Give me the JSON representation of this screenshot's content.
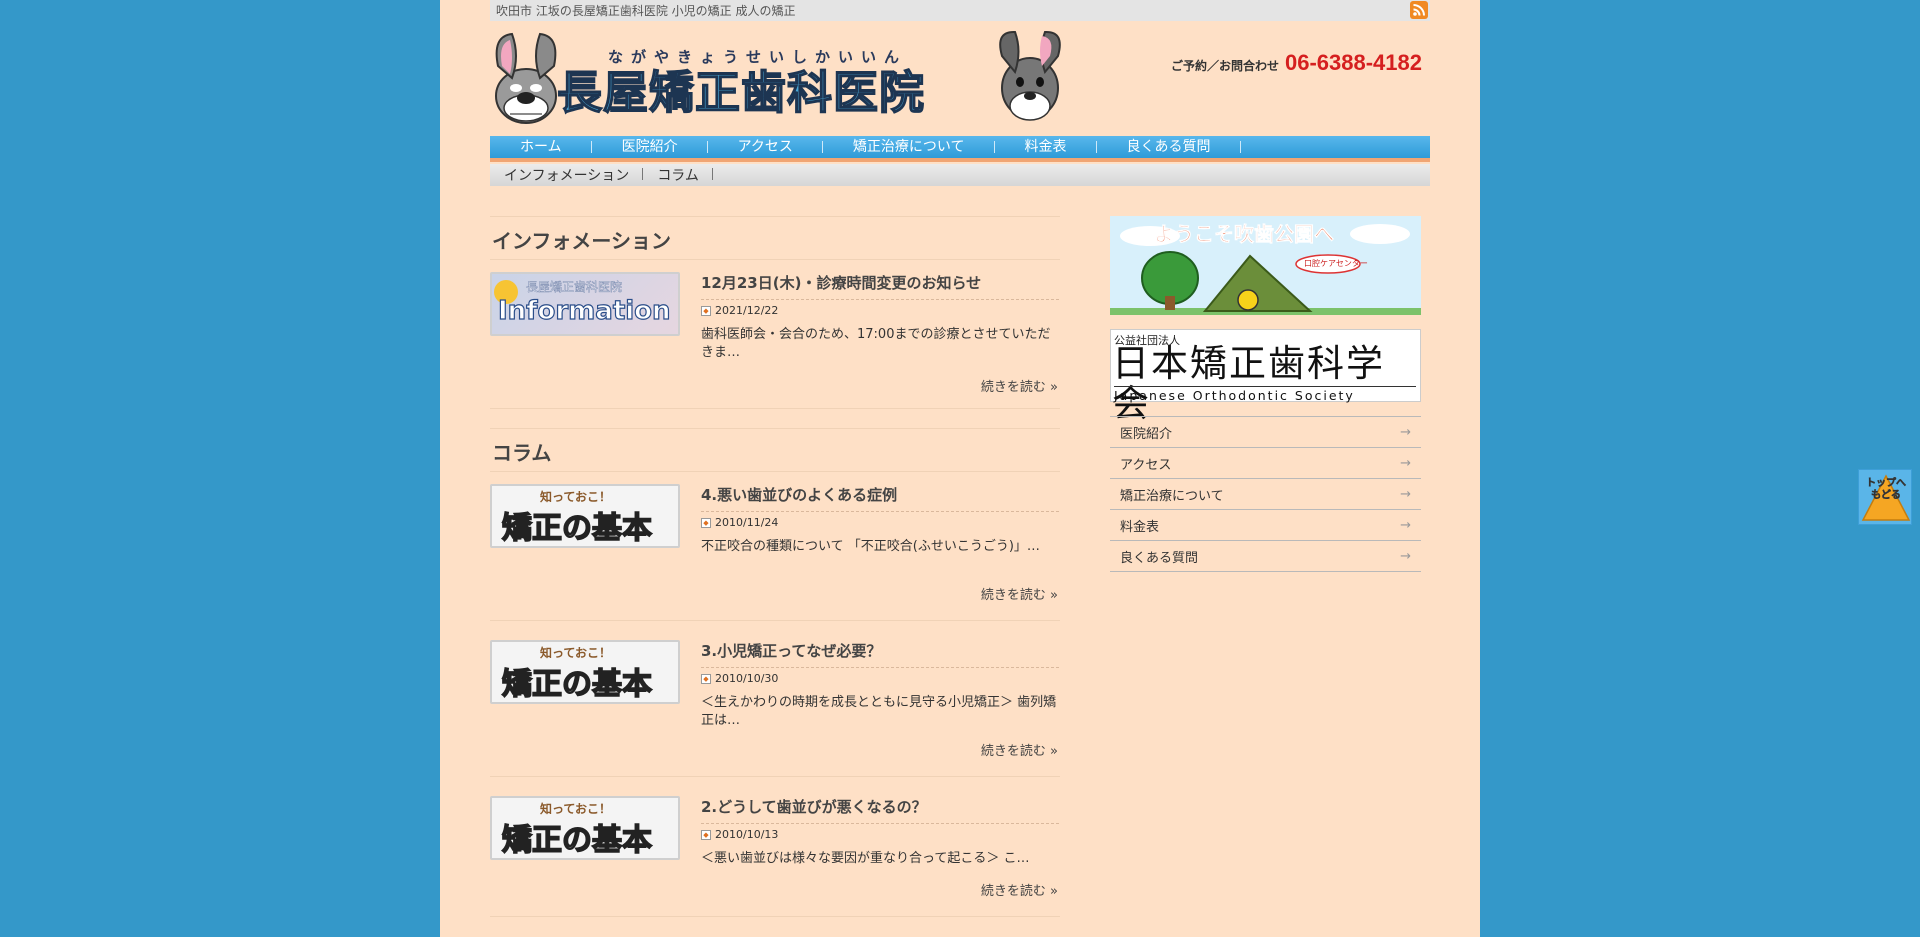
{
  "topbar": {
    "tagline": "吹田市 江坂の長屋矯正歯科医院 小児の矯正 成人の矯正"
  },
  "header": {
    "logo_ruby": "ながやきょうせいしかいいん",
    "logo_text": "長屋矯正歯科医院",
    "tel_label": "ご予約／お問合わせ",
    "tel_number": "06-6388-4182"
  },
  "nav": {
    "items": [
      "ホーム",
      "医院紹介",
      "アクセス",
      "矯正治療について",
      "料金表",
      "良くある質問"
    ]
  },
  "subnav": {
    "items": [
      "インフォメーション",
      "コラム"
    ]
  },
  "info": {
    "title": "インフォメーション",
    "thumb_small": "長屋矯正歯科医院",
    "thumb_big": "Information",
    "posts": [
      {
        "title": "12月23日(木)・診療時間変更のお知らせ",
        "date": "2021/12/22",
        "excerpt": "歯科医師会・会合のため、17:00までの診療とさせていただきま…",
        "more": "続きを読む »"
      }
    ]
  },
  "column": {
    "title": "コラム",
    "thumb_small": "知っておこ！",
    "thumb_big": "矯正の基本",
    "posts": [
      {
        "title": "4.悪い歯並びのよくある症例",
        "date": "2010/11/24",
        "excerpt": "  不正咬合の種類について 「不正咬合(ふせいこうごう)」…",
        "more": "続きを読む »"
      },
      {
        "title": "3.小児矯正ってなぜ必要？",
        "date": "2010/10/30",
        "excerpt": "＜生えかわりの時期を成長とともに見守る小児矯正＞ 歯列矯正は…",
        "more": "続きを読む »"
      },
      {
        "title": "2.どうして歯並びが悪くなるの？",
        "date": "2010/10/13",
        "excerpt": "＜悪い歯並びは様々な要因が重なり合って起こる＞ こ…",
        "more": "続きを読む »"
      }
    ]
  },
  "sidebar": {
    "banner1_text": "ようこそ吹歯公園へ",
    "banner1_sign": "口腔ケアセンター",
    "banner2_small": "公益社団法人",
    "banner2_main": "日本矯正歯科学会",
    "banner2_eng": "Japanese Orthodontic Society",
    "menu": [
      "医院紹介",
      "アクセス",
      "矯正治療について",
      "料金表",
      "良くある質問"
    ],
    "arrow": "→"
  },
  "back_top": {
    "label": "トップへもどる"
  },
  "colors": {
    "page_bg": "#fee0c6",
    "body_bg": "#3498c9",
    "nav": "#3aa4e0",
    "tel": "#d51f1f"
  }
}
